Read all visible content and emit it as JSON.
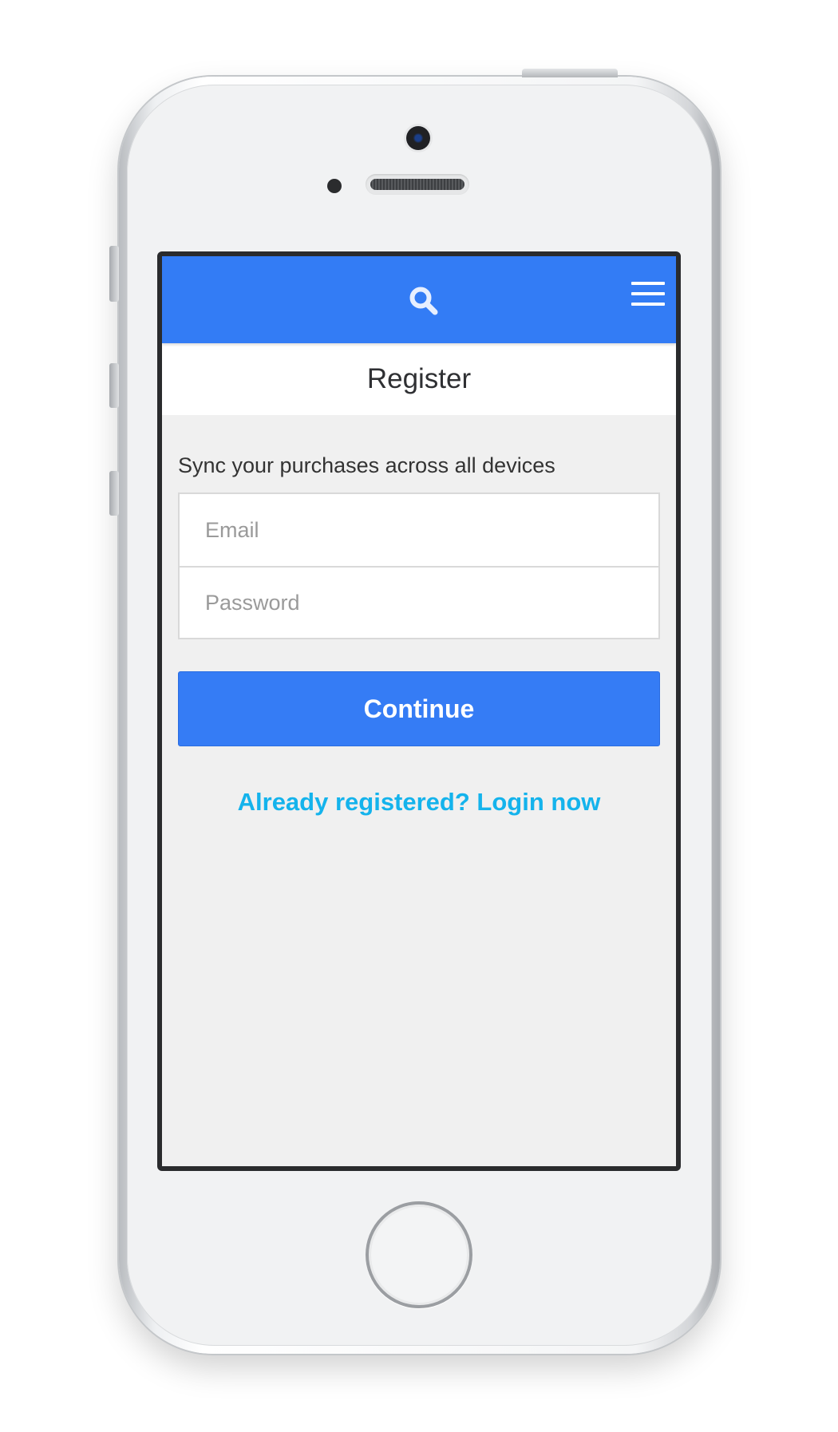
{
  "header": {
    "search_icon": "search-icon",
    "menu_icon": "hamburger-menu-icon",
    "color": "#337cf5"
  },
  "page": {
    "title": "Register"
  },
  "form": {
    "subtitle": "Sync your purchases across all devices",
    "email": {
      "placeholder": "Email",
      "value": ""
    },
    "password": {
      "placeholder": "Password",
      "value": ""
    },
    "continue_label": "Continue",
    "login_link": "Already registered? Login now",
    "button_color": "#357cf5",
    "link_color": "#14b3ec"
  }
}
